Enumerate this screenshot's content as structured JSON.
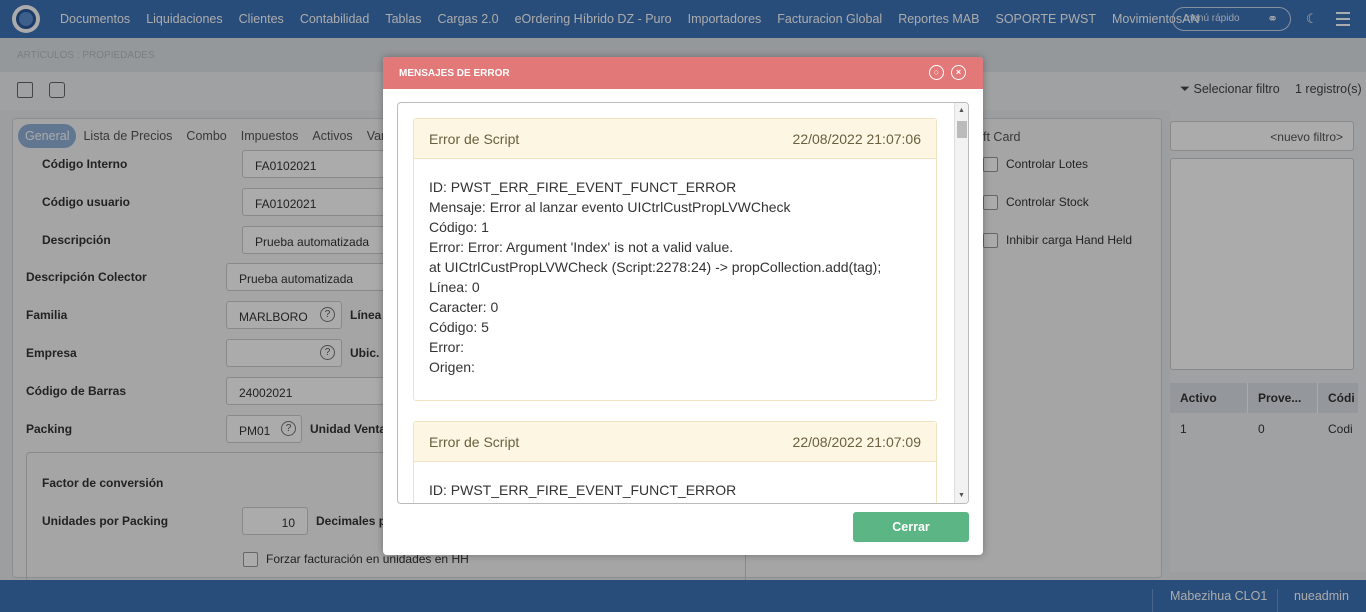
{
  "menu": [
    "Documentos",
    "Liquidaciones",
    "Clientes",
    "Contabilidad",
    "Tablas",
    "Cargas 2.0",
    "eOrdering Híbrido DZ - Puro",
    "Importadores",
    "Facturacion Global",
    "Reportes MAB",
    "SOPORTE PWST",
    "MovimientosAN"
  ],
  "quick_menu": "menú rápido",
  "breadcrumb": "ARTÍCULOS : PROPIEDADES",
  "filter": {
    "select_label": "Selecionar filtro",
    "count": "1 registro(s)",
    "new_filter": "<nuevo filtro>"
  },
  "tabs": [
    "General",
    "Lista de Precios",
    "Combo",
    "Impuestos",
    "Activos",
    "Vari",
    "ft Card"
  ],
  "form": {
    "codigo_interno_label": "Código Interno",
    "codigo_interno": "FA0102021",
    "codigo_usuario_label": "Código usuario",
    "codigo_usuario": "FA0102021",
    "descripcion_label": "Descripción",
    "descripcion": "Prueba automatizada",
    "desc_colector_label": "Descripción Colector",
    "desc_colector": "Prueba automatizada",
    "familia_label": "Familia",
    "familia": "MARLBORO",
    "linea_label": "Línea d",
    "empresa_label": "Empresa",
    "ubic_label": "Ubic. D",
    "codigo_barras_label": "Código de Barras",
    "codigo_barras": "24002021",
    "packing_label": "Packing",
    "packing": "PM01",
    "unidad_venta_label": "Unidad Venta",
    "factor_label": "Factor de conversión",
    "unidades_label": "Unidades por Packing",
    "unidades": "10",
    "decimales_label": "Decimales pe",
    "forzar_label": "Forzar facturación en unidades en HH",
    "controlar_lotes": "Controlar Lotes",
    "controlar_stock": "Controlar Stock",
    "inhibir": "Inhibir carga Hand Held"
  },
  "grid": {
    "headers": [
      "Activo",
      "Prove...",
      "Códi"
    ],
    "row": [
      "1",
      "0",
      "Codi"
    ]
  },
  "status": {
    "company": "Mabezihua CLO1",
    "user": "nueadmin"
  },
  "modal": {
    "title": "MENSAJES DE ERROR",
    "errors": [
      {
        "title": "Error de Script",
        "date": "22/08/2022 21:07:06",
        "lines": [
          "ID: PWST_ERR_FIRE_EVENT_FUNCT_ERROR",
          "Mensaje: Error al lanzar evento UICtrlCustPropLVWCheck",
          "Código: 1",
          "Error: Error: Argument 'Index' is not a valid value.",
          "at UICtrlCustPropLVWCheck (Script:2278:24) -> propCollection.add(tag);",
          "Línea: 0",
          "Caracter: 0",
          "Código: 5",
          "Error:",
          "Origen:"
        ]
      },
      {
        "title": "Error de Script",
        "date": "22/08/2022 21:07:09",
        "lines": [
          "ID: PWST_ERR_FIRE_EVENT_FUNCT_ERROR"
        ]
      }
    ],
    "close_button": "Cerrar"
  }
}
